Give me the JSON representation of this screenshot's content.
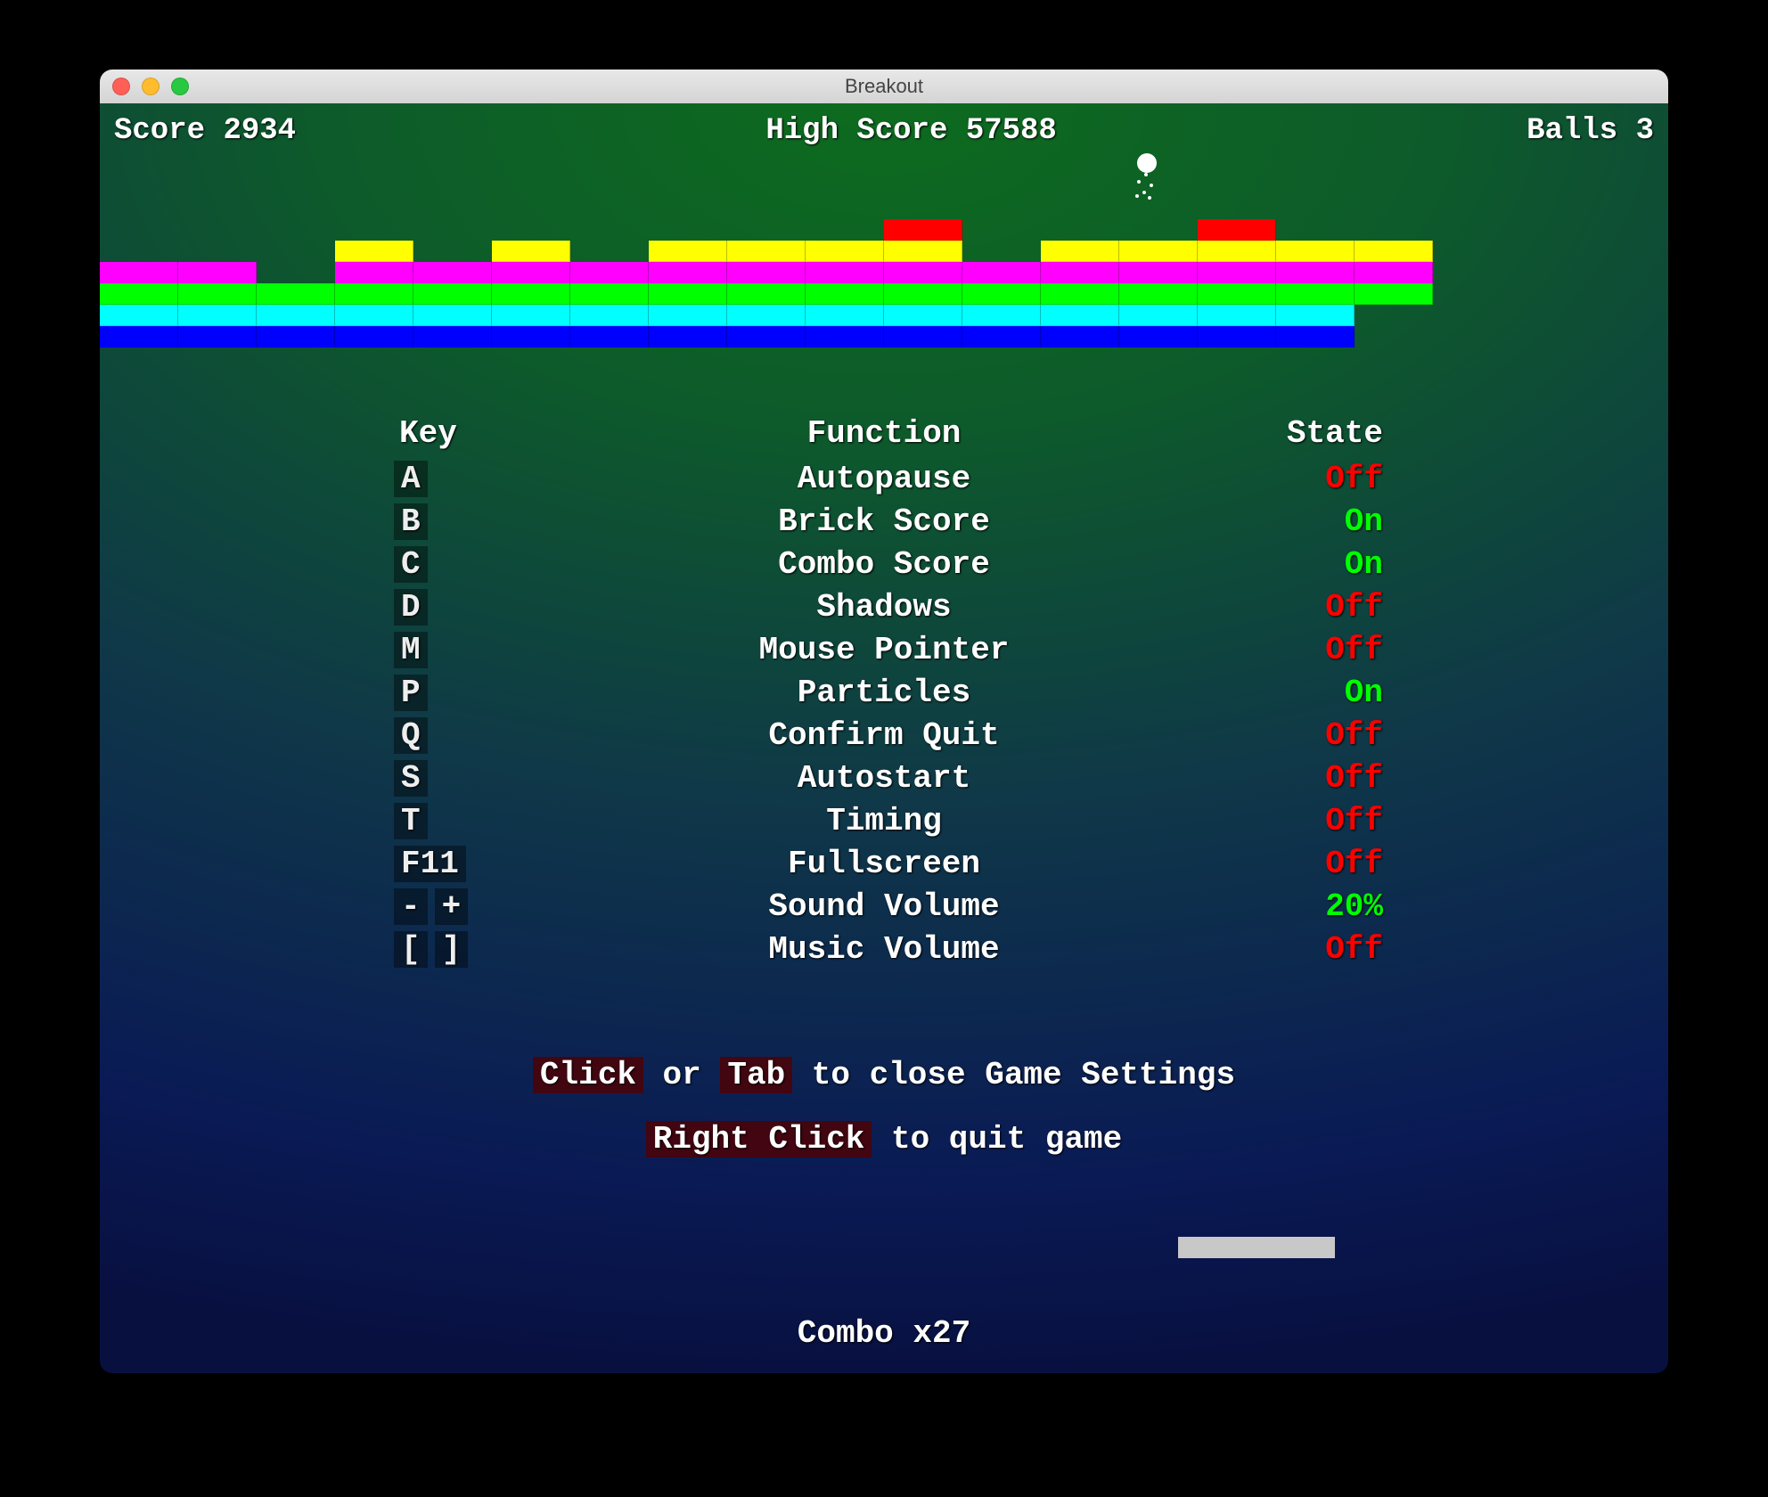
{
  "window": {
    "title": "Breakout"
  },
  "hud": {
    "score_label": "Score",
    "score_value": "2934",
    "highscore_label": "High Score",
    "highscore_value": "57588",
    "balls_label": "Balls",
    "balls_value": "3"
  },
  "bricks": {
    "cols": 18,
    "rows": [
      {
        "color": "red",
        "cells": [
          0,
          0,
          0,
          0,
          0,
          0,
          0,
          0,
          0,
          0,
          1,
          0,
          0,
          0,
          1,
          0,
          0,
          0
        ]
      },
      {
        "color": "yellow",
        "cells": [
          0,
          0,
          0,
          1,
          0,
          1,
          0,
          1,
          1,
          1,
          1,
          0,
          1,
          1,
          1,
          1,
          1,
          0
        ]
      },
      {
        "color": "magenta",
        "cells": [
          1,
          1,
          0,
          1,
          1,
          1,
          1,
          1,
          1,
          1,
          1,
          1,
          1,
          1,
          1,
          1,
          1,
          0
        ]
      },
      {
        "color": "green",
        "cells": [
          1,
          1,
          1,
          1,
          1,
          1,
          1,
          1,
          1,
          1,
          1,
          1,
          1,
          1,
          1,
          1,
          1,
          0
        ]
      },
      {
        "color": "cyan",
        "cells": [
          1,
          1,
          1,
          1,
          1,
          1,
          1,
          1,
          1,
          1,
          1,
          1,
          1,
          1,
          1,
          1,
          0,
          0
        ]
      },
      {
        "color": "blue",
        "cells": [
          1,
          1,
          1,
          1,
          1,
          1,
          1,
          1,
          1,
          1,
          1,
          1,
          1,
          1,
          1,
          1,
          0,
          0
        ]
      }
    ]
  },
  "settings": {
    "headers": {
      "key": "Key",
      "function": "Function",
      "state": "State"
    },
    "rows": [
      {
        "keys": [
          "A"
        ],
        "function": "Autopause",
        "state": "Off"
      },
      {
        "keys": [
          "B"
        ],
        "function": "Brick Score",
        "state": "On"
      },
      {
        "keys": [
          "C"
        ],
        "function": "Combo Score",
        "state": "On"
      },
      {
        "keys": [
          "D"
        ],
        "function": "Shadows",
        "state": "Off"
      },
      {
        "keys": [
          "M"
        ],
        "function": "Mouse Pointer",
        "state": "Off"
      },
      {
        "keys": [
          "P"
        ],
        "function": "Particles",
        "state": "On"
      },
      {
        "keys": [
          "Q"
        ],
        "function": "Confirm Quit",
        "state": "Off"
      },
      {
        "keys": [
          "S"
        ],
        "function": "Autostart",
        "state": "Off"
      },
      {
        "keys": [
          "T"
        ],
        "function": "Timing",
        "state": "Off"
      },
      {
        "keys": [
          "F11"
        ],
        "function": "Fullscreen",
        "state": "Off"
      },
      {
        "keys": [
          "-",
          "+"
        ],
        "function": "Sound Volume",
        "state": "20%"
      },
      {
        "keys": [
          "[",
          "]"
        ],
        "function": "Music Volume",
        "state": "Off"
      }
    ]
  },
  "hints": {
    "close_key1": "Click",
    "close_mid": " or ",
    "close_key2": "Tab",
    "close_rest": " to close Game Settings",
    "quit_key": "Right Click",
    "quit_rest": " to quit game"
  },
  "combo": {
    "label": "Combo",
    "value": "x27"
  },
  "state_colors": {
    "On": "st-on",
    "Off": "st-off",
    "20%": "st-on"
  }
}
